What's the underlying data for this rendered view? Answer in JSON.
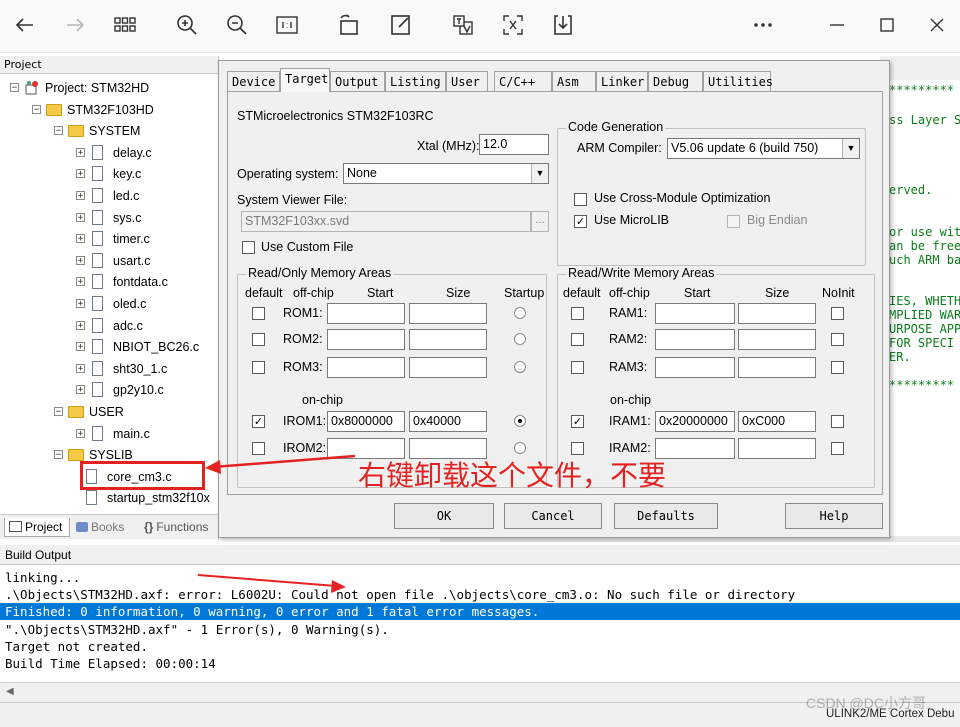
{
  "project_panel": {
    "title": "Project",
    "tree": [
      {
        "label": "Project: STM32HD",
        "type": "project",
        "depth": 0
      },
      {
        "label": "STM32F103HD",
        "type": "target",
        "depth": 1
      },
      {
        "label": "SYSTEM",
        "type": "folder",
        "depth": 2
      },
      {
        "label": "delay.c",
        "type": "file",
        "depth": 3
      },
      {
        "label": "key.c",
        "type": "file",
        "depth": 3
      },
      {
        "label": "led.c",
        "type": "file",
        "depth": 3
      },
      {
        "label": "sys.c",
        "type": "file",
        "depth": 3
      },
      {
        "label": "timer.c",
        "type": "file",
        "depth": 3
      },
      {
        "label": "usart.c",
        "type": "file",
        "depth": 3
      },
      {
        "label": "fontdata.c",
        "type": "file",
        "depth": 3
      },
      {
        "label": "oled.c",
        "type": "file",
        "depth": 3
      },
      {
        "label": "adc.c",
        "type": "file",
        "depth": 3
      },
      {
        "label": "NBIOT_BC26.c",
        "type": "file",
        "depth": 3
      },
      {
        "label": "sht30_1.c",
        "type": "file",
        "depth": 3
      },
      {
        "label": "gp2y10.c",
        "type": "file",
        "depth": 3
      },
      {
        "label": "USER",
        "type": "folder",
        "depth": 2
      },
      {
        "label": "main.c",
        "type": "file",
        "depth": 3
      },
      {
        "label": "SYSLIB",
        "type": "folder",
        "depth": 2
      },
      {
        "label": "core_cm3.c",
        "type": "file-noexp",
        "depth": 3
      },
      {
        "label": "startup_stm32f10x",
        "type": "file-noexp",
        "depth": 3
      }
    ],
    "tabs": {
      "project": "Project",
      "books": "Books",
      "functions": "Functions"
    }
  },
  "editor": {
    "lines": [
      "*********",
      "ss Layer S",
      "",
      "",
      "erved.",
      "",
      "or use wit",
      "an be free",
      "uch ARM ba",
      "",
      "IES, WHETH",
      "MPLIED WAR",
      "URPOSE APP",
      " FOR SPECI",
      "ER.",
      "",
      "*********"
    ]
  },
  "dialog": {
    "tabs": [
      "Device",
      "Target",
      "Output",
      "Listing",
      "User",
      "C/C++",
      "Asm",
      "Linker",
      "Debug",
      "Utilities"
    ],
    "active_tab": "Target",
    "device_name": "STMicroelectronics STM32F103RC",
    "xtal_label": "Xtal (MHz):",
    "xtal_value": "12.0",
    "os_label": "Operating system:",
    "os_value": "None",
    "svf_label": "System Viewer File:",
    "svf_value": "STM32F103xx.svd",
    "custom_file_label": "Use Custom File",
    "code_gen": {
      "title": "Code Generation",
      "compiler_label": "ARM Compiler:",
      "compiler_value": "V5.06 update 6 (build 750)",
      "cross_module_label": "Use Cross-Module Optimization",
      "microlib_label": "Use MicroLIB",
      "big_endian_label": "Big Endian"
    },
    "rom": {
      "title": "Read/Only Memory Areas",
      "headers": {
        "default": "default",
        "offchip": "off-chip",
        "start": "Start",
        "size": "Size",
        "startup": "Startup"
      },
      "onchip_label": "on-chip",
      "rows": [
        {
          "name": "ROM1:",
          "start": "",
          "size": ""
        },
        {
          "name": "ROM2:",
          "start": "",
          "size": ""
        },
        {
          "name": "ROM3:",
          "start": "",
          "size": ""
        },
        {
          "name": "IROM1:",
          "start": "0x8000000",
          "size": "0x40000"
        },
        {
          "name": "IROM2:",
          "start": "",
          "size": ""
        }
      ]
    },
    "ram": {
      "title": "Read/Write Memory Areas",
      "headers": {
        "default": "default",
        "offchip": "off-chip",
        "start": "Start",
        "size": "Size",
        "noinit": "NoInit"
      },
      "onchip_label": "on-chip",
      "rows": [
        {
          "name": "RAM1:",
          "start": "",
          "size": ""
        },
        {
          "name": "RAM2:",
          "start": "",
          "size": ""
        },
        {
          "name": "RAM3:",
          "start": "",
          "size": ""
        },
        {
          "name": "IRAM1:",
          "start": "0x20000000",
          "size": "0xC000"
        },
        {
          "name": "IRAM2:",
          "start": "",
          "size": ""
        }
      ]
    },
    "buttons": {
      "ok": "OK",
      "cancel": "Cancel",
      "defaults": "Defaults",
      "help": "Help"
    }
  },
  "build_output": {
    "title": "Build Output",
    "lines": [
      "linking...",
      ".\\Objects\\STM32HD.axf: error: L6002U: Could not open file .\\objects\\core_cm3.o: No such file or directory",
      "Finished: 0 information, 0 warning, 0 error and 1 fatal error messages.",
      "\".\\Objects\\STM32HD.axf\" - 1 Error(s), 0 Warning(s).",
      "Target not created.",
      "Build Time Elapsed:  00:00:14"
    ]
  },
  "status_bar": {
    "debugger": "ULINK2/ME Cortex Debu",
    "watermark": "CSDN @DC小方哥"
  },
  "annotation": {
    "text": "右键卸载这个文件，不要",
    "color": "#e52222"
  },
  "colors": {
    "selection": "#0078d7",
    "editor_text": "#0b7d1a",
    "annotation": "#e52222"
  }
}
